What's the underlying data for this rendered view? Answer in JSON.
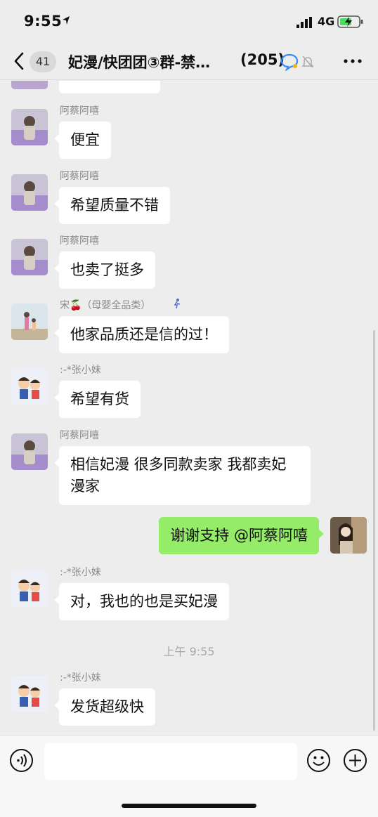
{
  "status_bar": {
    "time": "9:55",
    "network": "4G"
  },
  "nav": {
    "unread_count": "41",
    "title": "妃漫/快团团③群-禁…",
    "member_count": "(205)"
  },
  "messages": [
    {
      "sender": "阿蔡阿嘻",
      "text": "便宜",
      "avatar": "flower-field-avatar"
    },
    {
      "sender": "阿蔡阿嘻",
      "text": "希望质量不错",
      "avatar": "flower-field-avatar"
    },
    {
      "sender": "阿蔡阿嘻",
      "text": "也卖了挺多",
      "avatar": "flower-field-avatar"
    },
    {
      "sender": "宋🍒（母婴全品类）",
      "text": "他家品质还是信的过！",
      "avatar": "beach-family-avatar"
    },
    {
      "sender": ":-*张小妹",
      "text": "希望有货",
      "avatar": "cartoon-kids-avatar"
    },
    {
      "sender": "阿蔡阿嘻",
      "text": "相信妃漫 很多同款卖家 我都卖妃漫家",
      "avatar": "flower-field-avatar"
    },
    {
      "sender": "",
      "text": "谢谢支持 @阿蔡阿嘻",
      "avatar": "self-avatar"
    },
    {
      "sender": ":-*张小妹",
      "text": "对，我也的也是买妃漫",
      "avatar": "cartoon-kids-avatar"
    },
    {
      "sender": ":-*张小妹",
      "text": "发货超级快",
      "avatar": "cartoon-kids-avatar"
    }
  ],
  "timestamp": "上午 9:55",
  "colors": {
    "outgoing_bubble": "#95ec69",
    "incoming_bubble": "#ffffff",
    "background": "#ededed"
  }
}
